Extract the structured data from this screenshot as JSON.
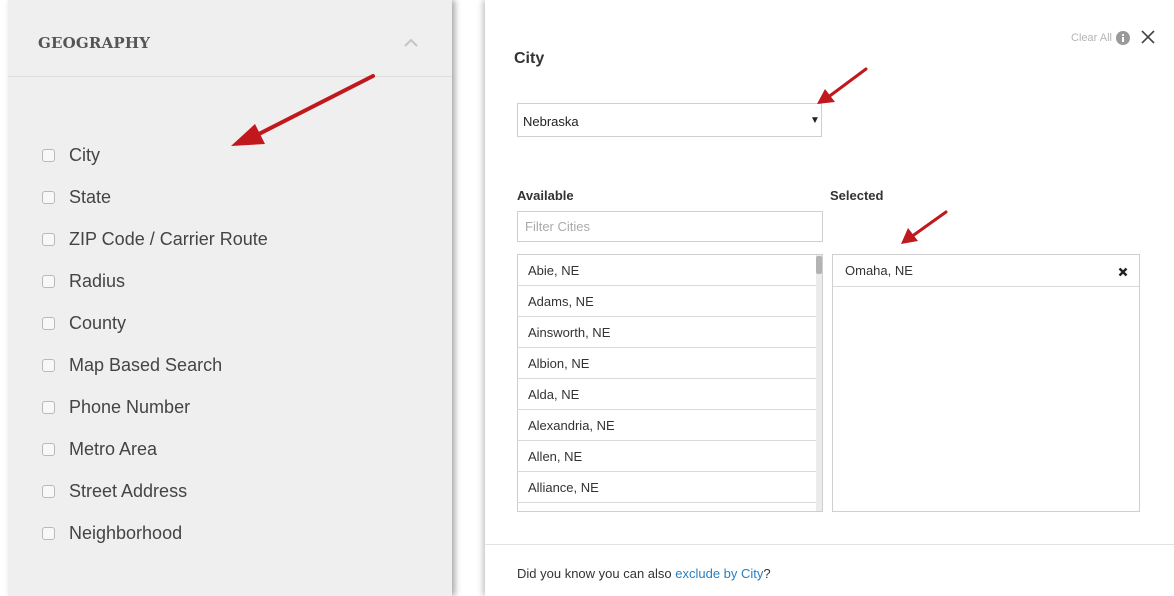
{
  "geography": {
    "title": "GEOGRAPHY",
    "items": [
      {
        "label": "City"
      },
      {
        "label": "State"
      },
      {
        "label": "ZIP Code / Carrier Route"
      },
      {
        "label": "Radius"
      },
      {
        "label": "County"
      },
      {
        "label": "Map Based Search"
      },
      {
        "label": "Phone Number"
      },
      {
        "label": "Metro Area"
      },
      {
        "label": "Street Address"
      },
      {
        "label": "Neighborhood"
      }
    ]
  },
  "city_panel": {
    "title": "City",
    "clear_all": "Clear All",
    "state_select": {
      "value": "Nebraska"
    },
    "available_label": "Available",
    "selected_label": "Selected",
    "filter": {
      "placeholder": "Filter Cities",
      "value": ""
    },
    "available": [
      "Abie, NE",
      "Adams, NE",
      "Ainsworth, NE",
      "Albion, NE",
      "Alda, NE",
      "Alexandria, NE",
      "Allen, NE",
      "Alliance, NE"
    ],
    "selected": [
      "Omaha, NE"
    ],
    "footer_prefix": "Did you know you can also ",
    "footer_link": "exclude by City",
    "footer_suffix": "?"
  },
  "colors": {
    "annotation_arrow": "#c0181d",
    "link": "#2a7fc1",
    "panel_bg": "#efefef"
  },
  "icons": [
    "chevron-up-icon",
    "info-icon",
    "close-icon",
    "caret-down-icon",
    "remove-icon"
  ]
}
